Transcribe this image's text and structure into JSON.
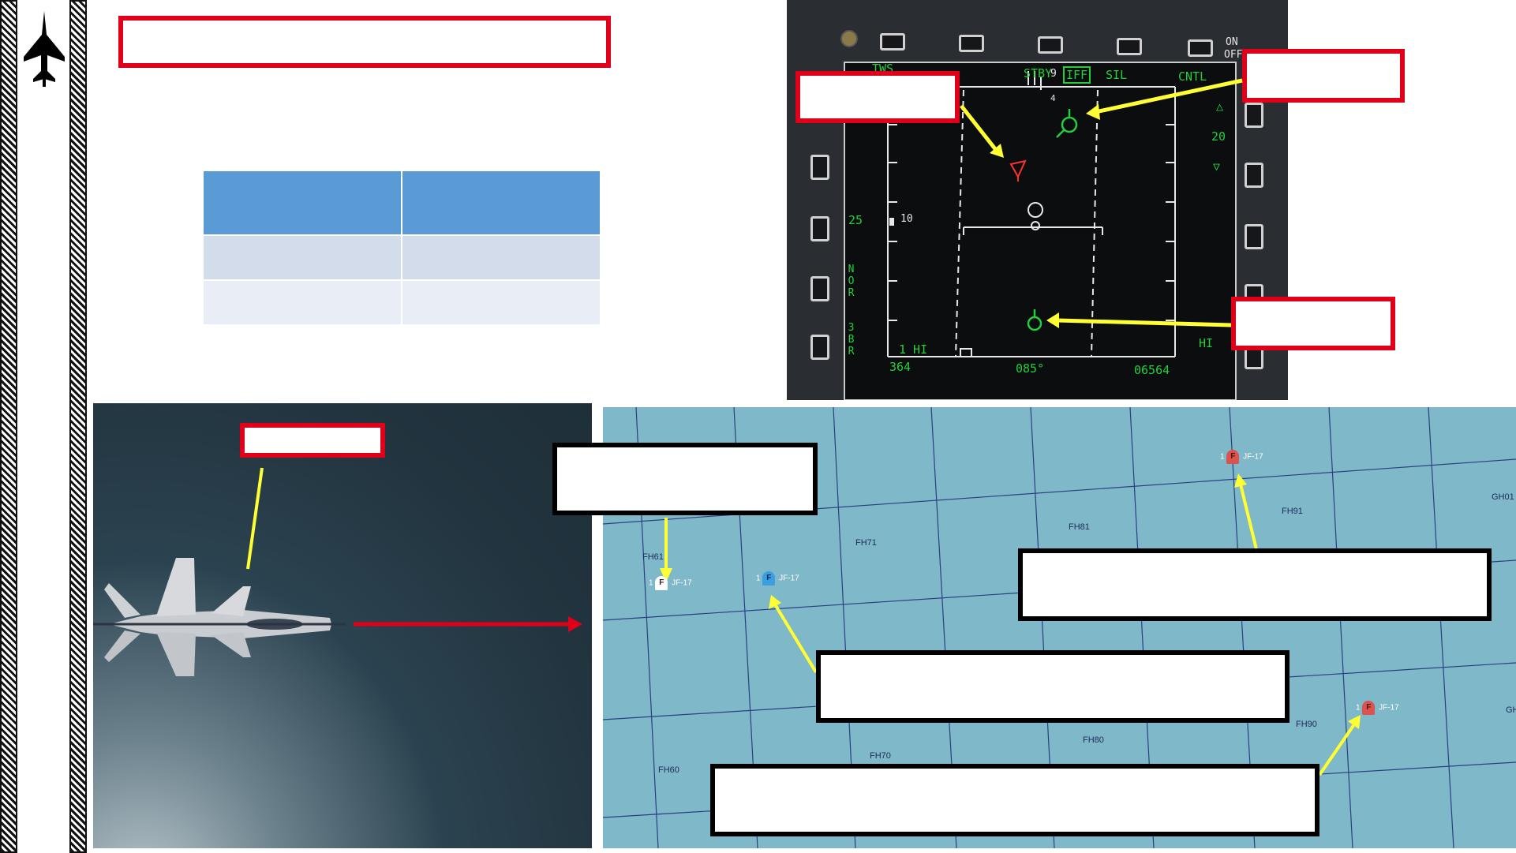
{
  "sidebar": {
    "logo_icon": "jet-silhouette-icon"
  },
  "title_box": {
    "label": ""
  },
  "table": {
    "header": [
      "",
      ""
    ],
    "rows": [
      [
        "",
        ""
      ],
      [
        "",
        ""
      ]
    ]
  },
  "radar": {
    "top_labels": {
      "tws": "TWS",
      "stby": "STBY",
      "iff": "IFF",
      "sil": "SIL",
      "cntl": "CNTL",
      "on": "ON",
      "off": "OFF"
    },
    "range_value": "20",
    "left_scale": "25",
    "scale_mark": "10",
    "nor": "NOR",
    "bar": "3BR",
    "hi_left": "1 HI",
    "hi_right": "HI",
    "heading": "364",
    "bearing": "085°",
    "altitude": "06564",
    "small_num_1": "9",
    "small_num_2": "4",
    "callouts": [
      "",
      "",
      ""
    ]
  },
  "photo": {
    "callout": ""
  },
  "map": {
    "grid_labels": [
      "FH61",
      "FH71",
      "FH81",
      "FH91",
      "GH01",
      "FH60",
      "FH70",
      "FH80",
      "FH90",
      "GH"
    ],
    "units": [
      {
        "id": "white",
        "marker": "F",
        "label": "JF-17",
        "prefix": "1",
        "color": "#ffffff"
      },
      {
        "id": "blue",
        "marker": "F",
        "label": "JF-17",
        "prefix": "1",
        "color": "#3b9ee0"
      },
      {
        "id": "red1",
        "marker": "F",
        "label": "JF-17",
        "prefix": "1",
        "color": "#d9534f"
      },
      {
        "id": "red2",
        "marker": "F",
        "label": "JF-17",
        "prefix": "1",
        "color": "#d9534f"
      }
    ],
    "callouts": [
      "",
      "",
      "",
      ""
    ]
  },
  "footer": {
    "text": ""
  },
  "colors": {
    "red": "#e0001a",
    "yellow": "#ffff33",
    "radar_green": "#22d03a"
  }
}
